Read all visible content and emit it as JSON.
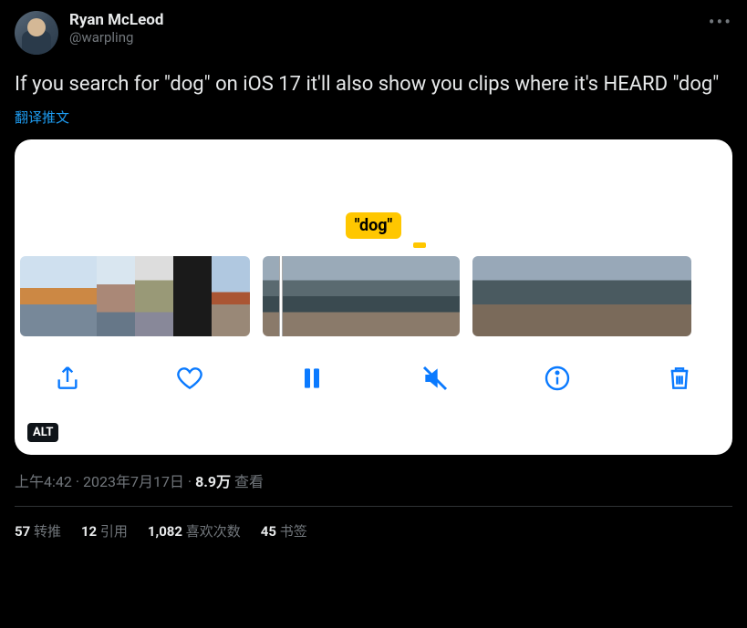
{
  "author": {
    "display_name": "Ryan McLeod",
    "handle": "@warpling"
  },
  "tweet_text": "If you search for \"dog\" on iOS 17 it'll also show you clips where it's HEARD \"dog\"",
  "translate_label": "翻译推文",
  "media": {
    "search_term": "\"dog\"",
    "alt_badge": "ALT",
    "controls": {
      "share": "share-icon",
      "like": "heart-icon",
      "pause": "pause-icon",
      "mute": "speaker-muted-icon",
      "info": "info-icon",
      "delete": "trash-icon"
    }
  },
  "meta": {
    "time": "上午4:42",
    "dot1": " · ",
    "date": "2023年7月17日",
    "dot2": " · ",
    "views_count": "8.9万",
    "views_label": " 查看"
  },
  "stats": {
    "retweets_count": "57",
    "retweets_label": " 转推",
    "quotes_count": "12",
    "quotes_label": " 引用",
    "likes_count": "1,082",
    "likes_label": " 喜欢次数",
    "bookmarks_count": "45",
    "bookmarks_label": " 书签"
  }
}
